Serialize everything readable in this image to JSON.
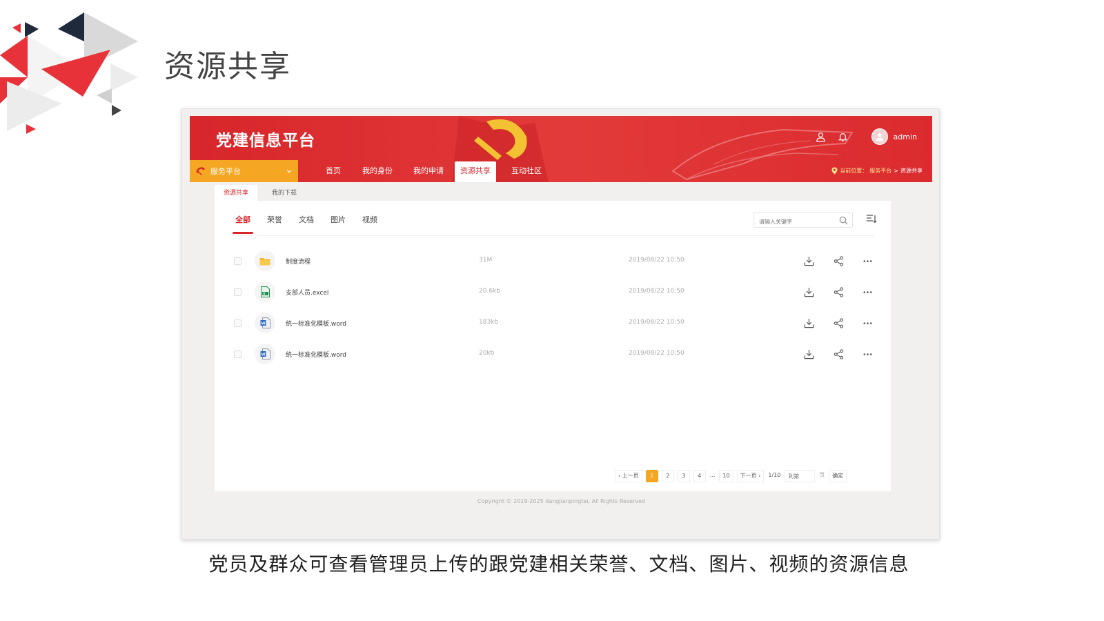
{
  "slide": {
    "title": "资源共享",
    "caption": "党员及群众可查看管理员上传的跟党建相关荣誉、文档、图片、视频的资源信息"
  },
  "header": {
    "platform_name": "党建信息平台",
    "icons": [
      "user-icon",
      "bell-icon"
    ],
    "username": "admin"
  },
  "nav": {
    "service_label": "服务平台",
    "items": [
      {
        "label": "首页"
      },
      {
        "label": "我的身份"
      },
      {
        "label": "我的申请"
      },
      {
        "label": "资源共享",
        "active": true
      },
      {
        "label": "互动社区"
      }
    ],
    "location_prefix": "当前位置：",
    "location_parent": "服务平台",
    "location_sep": ">",
    "location_current": "资源共享"
  },
  "subtabs": [
    {
      "label": "资源共享",
      "active": true
    },
    {
      "label": "我的下载"
    }
  ],
  "categories": [
    {
      "label": "全部",
      "active": true
    },
    {
      "label": "荣誉"
    },
    {
      "label": "文档"
    },
    {
      "label": "图片"
    },
    {
      "label": "视频"
    }
  ],
  "search": {
    "placeholder": "请输入关键字"
  },
  "files": [
    {
      "name": "制度流程",
      "size": "31M",
      "date": "2019/08/22 10:50",
      "icon": "folder-icon"
    },
    {
      "name": "支部人员.excel",
      "size": "20.6kb",
      "date": "2019/08/22 10:50",
      "icon": "excel-icon"
    },
    {
      "name": "统一标准化模板.word",
      "size": "183kb",
      "date": "2019/08/22 10:50",
      "icon": "word-icon"
    },
    {
      "name": "统一标准化模板.word",
      "size": "20kb",
      "date": "2019/08/22 10:50",
      "icon": "word-icon"
    }
  ],
  "pagination": {
    "prev": "上一页",
    "pages": [
      "1",
      "2",
      "3",
      "4",
      "...",
      "10"
    ],
    "current": "1",
    "next": "下一页",
    "total": "1/10",
    "goto_placeholder": "到第",
    "page_unit": "页",
    "confirm": "确定"
  },
  "footer": {
    "copyright": "Copyright © 2019-2025 dangjianpingtai, All Rights Reserved"
  },
  "colors": {
    "primary_red": "#d8262b",
    "accent_orange": "#f5a623"
  }
}
